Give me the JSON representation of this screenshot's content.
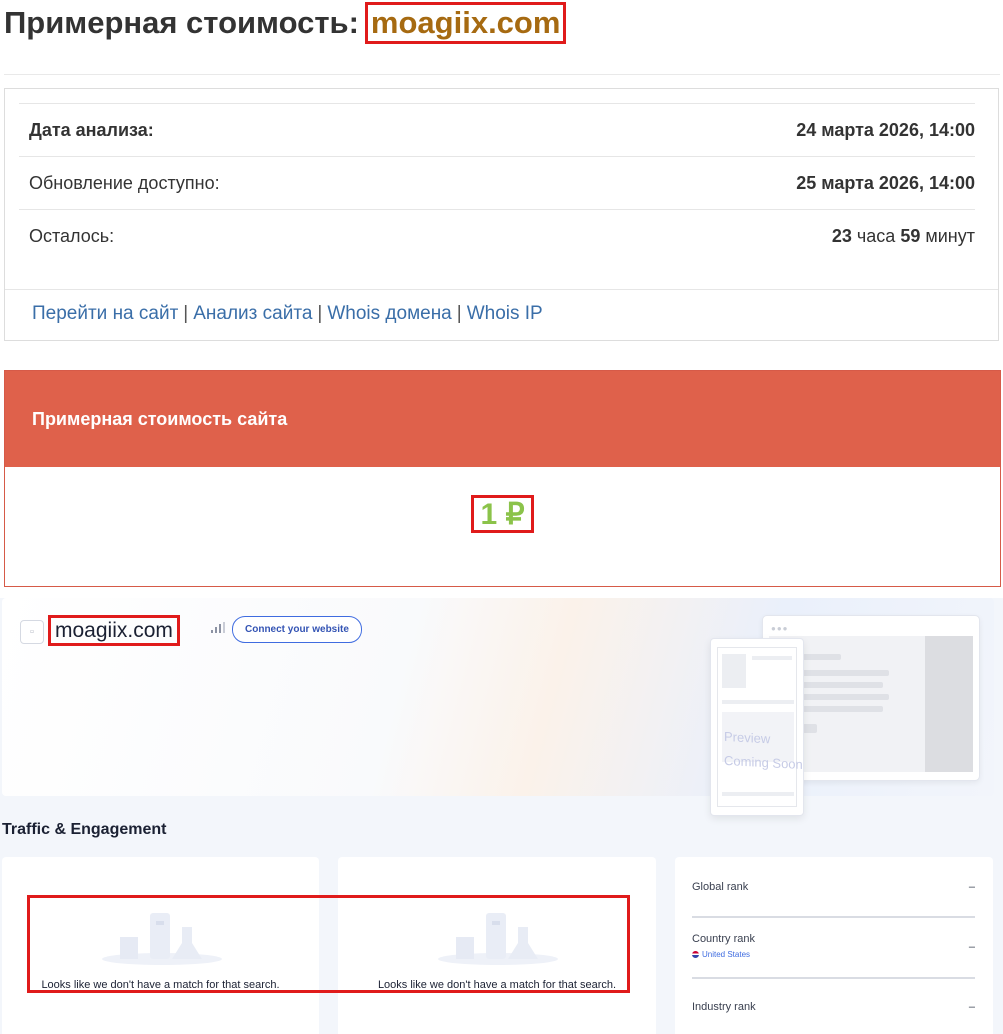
{
  "header": {
    "title_prefix": "Примерная стоимость:",
    "domain": "moagiix.com"
  },
  "info": {
    "rows": [
      {
        "label": "Дата анализа:",
        "value": "24 марта 2026, 14:00"
      },
      {
        "label": "Обновление доступно:",
        "value": "25 марта 2026, 14:00"
      }
    ],
    "remaining": {
      "label": "Осталось:",
      "hours": "23",
      "hours_unit": "часа",
      "minutes": "59",
      "minutes_unit": "минут"
    },
    "links": [
      "Перейти на сайт",
      "Анализ сайта",
      "Whois домена",
      "Whois IP"
    ],
    "separator": "|"
  },
  "cost": {
    "heading": "Примерная стоимость сайта",
    "value": "1 ₽"
  },
  "similarweb": {
    "domain": "moagiix.com",
    "connect_label": "Connect your website",
    "preview_line1": "Preview",
    "preview_line2": "Coming Soon",
    "section_title": "Traffic & Engagement",
    "empty_message_1": "Looks like we don't have a match for that search.",
    "empty_message_2": "Looks like we don't have a match for that search.",
    "ranks": {
      "global_label": "Global rank",
      "global_value": "–",
      "country_label": "Country rank",
      "country_name": "United States",
      "country_value": "–",
      "industry_label": "Industry rank",
      "industry_value": "–"
    }
  },
  "colors": {
    "accent_red": "#df614b",
    "price_green": "#8bc34a",
    "domain_gold": "#a66a11",
    "link_blue": "#3a6ea8",
    "highlight_red": "#e01b1b"
  }
}
